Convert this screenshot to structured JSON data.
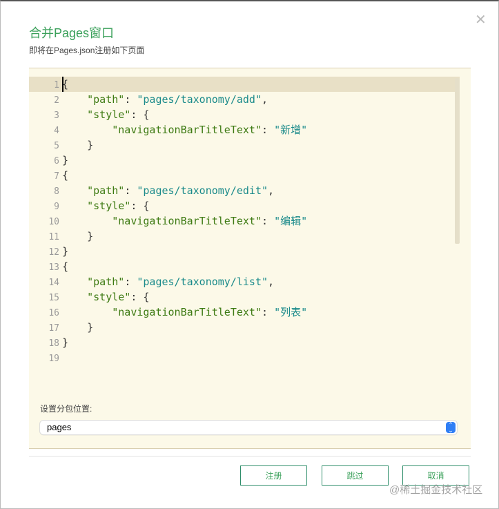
{
  "dialog": {
    "title": "合并Pages窗口",
    "subtitle": "即将在Pages.json注册如下页面",
    "close_icon": "close-icon"
  },
  "code_lines": [
    [
      [
        "p",
        "{"
      ]
    ],
    [
      [
        "p",
        "    "
      ],
      [
        "k",
        "\"path\""
      ],
      [
        "p",
        ": "
      ],
      [
        "s",
        "\"pages/taxonomy/add\""
      ],
      [
        "p",
        ","
      ]
    ],
    [
      [
        "p",
        "    "
      ],
      [
        "k",
        "\"style\""
      ],
      [
        "p",
        ": {"
      ]
    ],
    [
      [
        "p",
        "        "
      ],
      [
        "k",
        "\"navigationBarTitleText\""
      ],
      [
        "p",
        ": "
      ],
      [
        "s",
        "\"新增\""
      ]
    ],
    [
      [
        "p",
        "    }"
      ]
    ],
    [
      [
        "p",
        "}"
      ]
    ],
    [
      [
        "p",
        "{"
      ]
    ],
    [
      [
        "p",
        "    "
      ],
      [
        "k",
        "\"path\""
      ],
      [
        "p",
        ": "
      ],
      [
        "s",
        "\"pages/taxonomy/edit\""
      ],
      [
        "p",
        ","
      ]
    ],
    [
      [
        "p",
        "    "
      ],
      [
        "k",
        "\"style\""
      ],
      [
        "p",
        ": {"
      ]
    ],
    [
      [
        "p",
        "        "
      ],
      [
        "k",
        "\"navigationBarTitleText\""
      ],
      [
        "p",
        ": "
      ],
      [
        "s",
        "\"编辑\""
      ]
    ],
    [
      [
        "p",
        "    }"
      ]
    ],
    [
      [
        "p",
        "}"
      ]
    ],
    [
      [
        "p",
        "{"
      ]
    ],
    [
      [
        "p",
        "    "
      ],
      [
        "k",
        "\"path\""
      ],
      [
        "p",
        ": "
      ],
      [
        "s",
        "\"pages/taxonomy/list\""
      ],
      [
        "p",
        ","
      ]
    ],
    [
      [
        "p",
        "    "
      ],
      [
        "k",
        "\"style\""
      ],
      [
        "p",
        ": {"
      ]
    ],
    [
      [
        "p",
        "        "
      ],
      [
        "k",
        "\"navigationBarTitleText\""
      ],
      [
        "p",
        ": "
      ],
      [
        "s",
        "\"列表\""
      ]
    ],
    [
      [
        "p",
        "    }"
      ]
    ],
    [
      [
        "p",
        "}"
      ]
    ],
    [
      [
        "p",
        ""
      ]
    ]
  ],
  "subpackage": {
    "label": "设置分包位置:",
    "value": "pages"
  },
  "buttons": {
    "register": "注册",
    "skip": "跳过",
    "cancel": "取消"
  },
  "watermark": "@稀土掘金技术社区"
}
